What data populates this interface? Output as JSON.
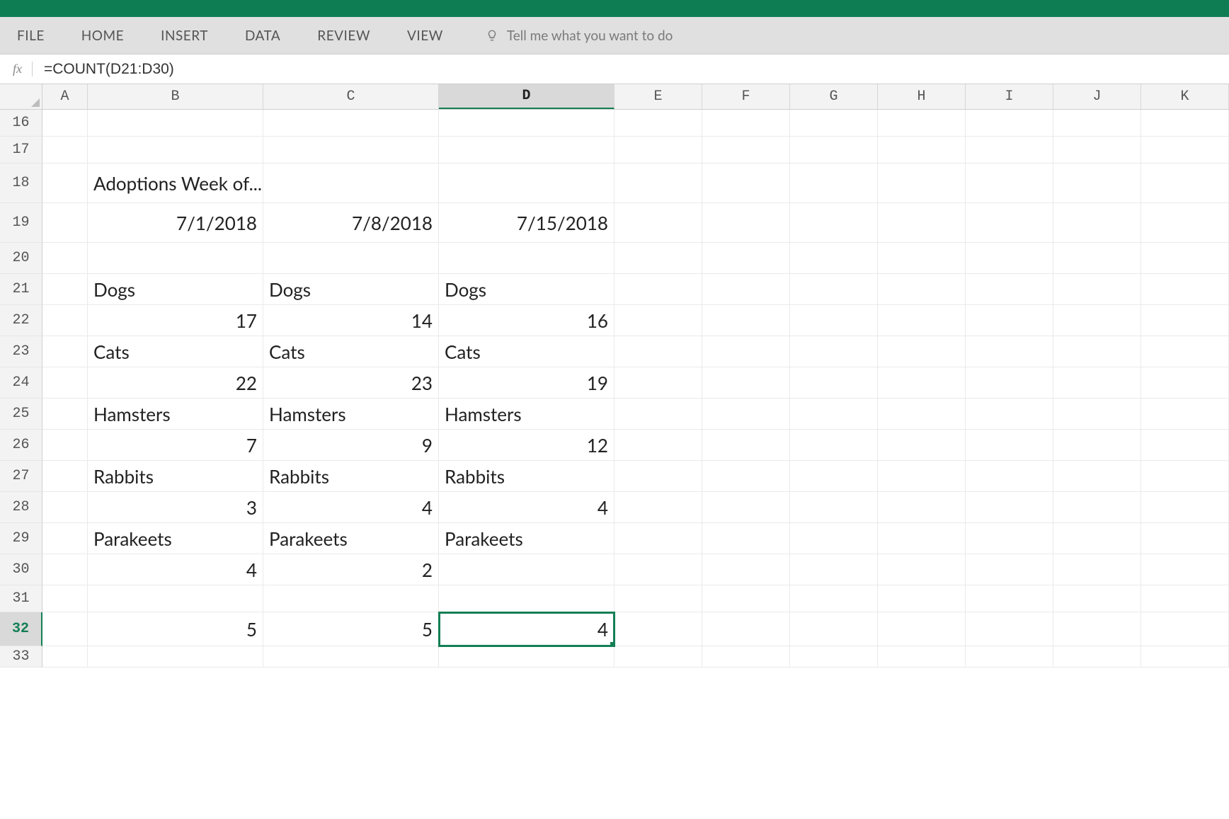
{
  "ribbon": {
    "tabs": [
      "FILE",
      "HOME",
      "INSERT",
      "DATA",
      "REVIEW",
      "VIEW"
    ],
    "tell_me_placeholder": "Tell me what you want to do"
  },
  "formula_bar": {
    "fx_label": "fx",
    "formula": "=COUNT(D21:D30)"
  },
  "columns": {
    "labels": [
      "A",
      "B",
      "C",
      "D",
      "E",
      "F",
      "G",
      "H",
      "I",
      "J",
      "K"
    ],
    "widths": [
      64,
      248,
      248,
      248,
      124,
      124,
      124,
      124,
      124,
      124,
      124
    ],
    "selected_index": 3
  },
  "rows": {
    "start": 16,
    "end": 33,
    "heights": {
      "16": 38,
      "17": 38,
      "18": 56,
      "19": 56,
      "20": 44,
      "21": 44,
      "22": 44,
      "23": 44,
      "24": 44,
      "25": 44,
      "26": 44,
      "27": 44,
      "28": 44,
      "29": 44,
      "30": 44,
      "31": 38,
      "32": 48,
      "33": 30
    },
    "selected": 32
  },
  "selection": {
    "col": 3,
    "row": 32
  },
  "cells": {
    "18": {
      "B": {
        "v": "Adoptions Week of...",
        "align": "left",
        "overflow": true
      }
    },
    "19": {
      "B": {
        "v": "7/1/2018",
        "align": "right"
      },
      "C": {
        "v": "7/8/2018",
        "align": "right"
      },
      "D": {
        "v": "7/15/2018",
        "align": "right"
      }
    },
    "21": {
      "B": {
        "v": "Dogs",
        "align": "left"
      },
      "C": {
        "v": "Dogs",
        "align": "left"
      },
      "D": {
        "v": "Dogs",
        "align": "left"
      }
    },
    "22": {
      "B": {
        "v": "17",
        "align": "right"
      },
      "C": {
        "v": "14",
        "align": "right"
      },
      "D": {
        "v": "16",
        "align": "right"
      }
    },
    "23": {
      "B": {
        "v": "Cats",
        "align": "left"
      },
      "C": {
        "v": "Cats",
        "align": "left"
      },
      "D": {
        "v": "Cats",
        "align": "left"
      }
    },
    "24": {
      "B": {
        "v": "22",
        "align": "right"
      },
      "C": {
        "v": "23",
        "align": "right"
      },
      "D": {
        "v": "19",
        "align": "right"
      }
    },
    "25": {
      "B": {
        "v": "Hamsters",
        "align": "left"
      },
      "C": {
        "v": "Hamsters",
        "align": "left"
      },
      "D": {
        "v": "Hamsters",
        "align": "left"
      }
    },
    "26": {
      "B": {
        "v": "7",
        "align": "right"
      },
      "C": {
        "v": "9",
        "align": "right"
      },
      "D": {
        "v": "12",
        "align": "right"
      }
    },
    "27": {
      "B": {
        "v": "Rabbits",
        "align": "left"
      },
      "C": {
        "v": "Rabbits",
        "align": "left"
      },
      "D": {
        "v": "Rabbits",
        "align": "left"
      }
    },
    "28": {
      "B": {
        "v": "3",
        "align": "right"
      },
      "C": {
        "v": "4",
        "align": "right"
      },
      "D": {
        "v": "4",
        "align": "right"
      }
    },
    "29": {
      "B": {
        "v": "Parakeets",
        "align": "left"
      },
      "C": {
        "v": "Parakeets",
        "align": "left"
      },
      "D": {
        "v": "Parakeets",
        "align": "left"
      }
    },
    "30": {
      "B": {
        "v": "4",
        "align": "right"
      },
      "C": {
        "v": "2",
        "align": "right"
      }
    },
    "32": {
      "B": {
        "v": "5",
        "align": "right"
      },
      "C": {
        "v": "5",
        "align": "right"
      },
      "D": {
        "v": "4",
        "align": "right"
      }
    }
  }
}
